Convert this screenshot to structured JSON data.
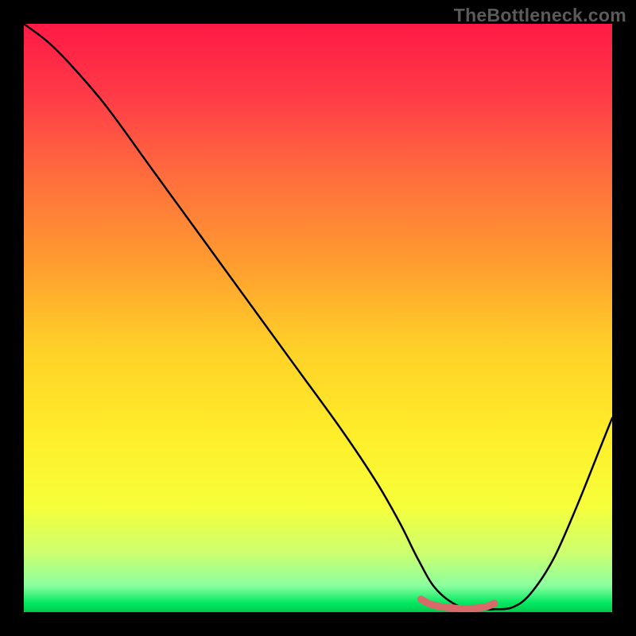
{
  "watermark": "TheBottleneck.com",
  "gradient": {
    "stops": [
      {
        "offset": 0.0,
        "color": "#ff1a45"
      },
      {
        "offset": 0.12,
        "color": "#ff3a48"
      },
      {
        "offset": 0.25,
        "color": "#ff6a3e"
      },
      {
        "offset": 0.4,
        "color": "#ff9a30"
      },
      {
        "offset": 0.55,
        "color": "#ffd028"
      },
      {
        "offset": 0.7,
        "color": "#ffee2a"
      },
      {
        "offset": 0.82,
        "color": "#f6ff3a"
      },
      {
        "offset": 0.9,
        "color": "#ccff70"
      },
      {
        "offset": 0.955,
        "color": "#8bff9f"
      },
      {
        "offset": 0.985,
        "color": "#00e860"
      },
      {
        "offset": 1.0,
        "color": "#00c94f"
      }
    ]
  },
  "chart_data": {
    "type": "line",
    "title": "",
    "xlabel": "",
    "ylabel": "",
    "xlim": [
      0,
      100
    ],
    "ylim": [
      0,
      100
    ],
    "series": [
      {
        "name": "curve-main",
        "x": [
          0,
          4,
          8,
          14,
          22,
          30,
          38,
          46,
          54,
          60,
          64,
          67,
          70,
          74,
          78,
          80,
          83,
          86,
          90,
          94,
          98,
          100
        ],
        "values": [
          100,
          97,
          93,
          86,
          75,
          64,
          53,
          42,
          31,
          22,
          15,
          9,
          4,
          1,
          0.5,
          0.5,
          0.8,
          3,
          9,
          18,
          28,
          33
        ]
      },
      {
        "name": "optimal-band",
        "x": [
          67.5,
          69,
          71,
          73,
          75,
          77,
          78.5,
          80
        ],
        "values": [
          2.2,
          1.4,
          0.9,
          0.7,
          0.6,
          0.7,
          0.9,
          1.5
        ]
      }
    ],
    "annotations": []
  }
}
